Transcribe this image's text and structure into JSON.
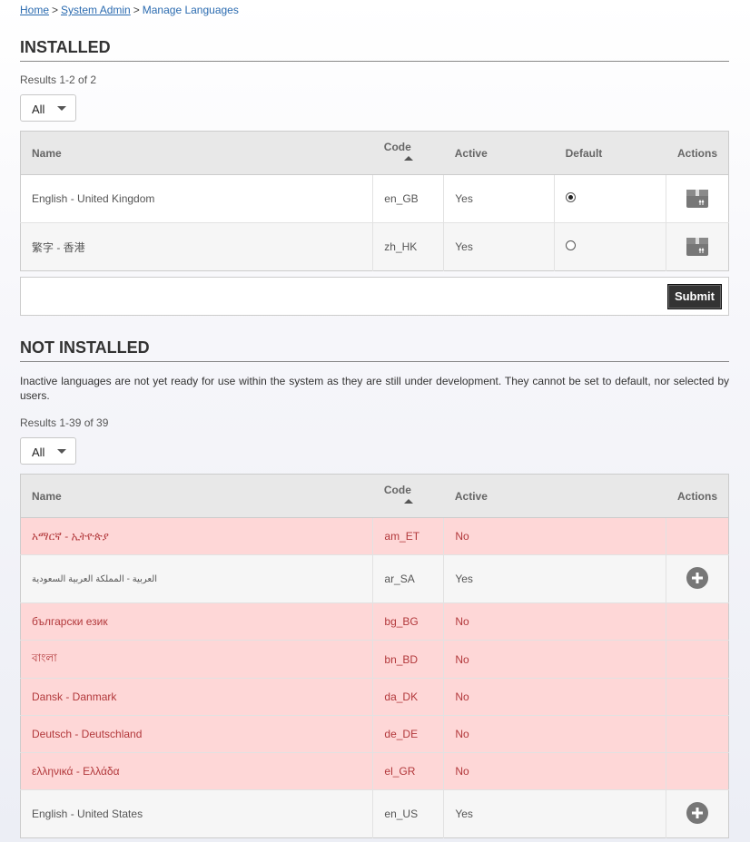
{
  "breadcrumb": {
    "home": "Home",
    "system_admin": "System Admin",
    "current": "Manage Languages",
    "separator": ">"
  },
  "installed": {
    "title": "INSTALLED",
    "results": "Results 1-2 of 2",
    "filter_value": "All",
    "headers": {
      "name": "Name",
      "code": "Code",
      "active": "Active",
      "default": "Default",
      "actions": "Actions"
    },
    "rows": [
      {
        "name": "English - United Kingdom",
        "code": "en_GB",
        "active": "Yes",
        "default_selected": true,
        "action_icon": "package-icon"
      },
      {
        "name": "繁字 - 香港",
        "code": "zh_HK",
        "active": "Yes",
        "default_selected": false,
        "action_icon": "package-icon"
      }
    ],
    "submit_label": "Submit"
  },
  "not_installed": {
    "title": "NOT INSTALLED",
    "description": "Inactive languages are not yet ready for use within the system as they are still under development. They cannot be set to default, nor selected by users.",
    "results": "Results 1-39 of 39",
    "filter_value": "All",
    "headers": {
      "name": "Name",
      "code": "Code",
      "active": "Active",
      "actions": "Actions"
    },
    "rows": [
      {
        "name": "አማርኛ - ኢትዮጵያ",
        "code": "am_ET",
        "active": "No",
        "installable": false
      },
      {
        "name": "العربية - المملكة العربية السعودية",
        "code": "ar_SA",
        "active": "Yes",
        "installable": true
      },
      {
        "name": "български език",
        "code": "bg_BG",
        "active": "No",
        "installable": false
      },
      {
        "name": "বাংলা",
        "code": "bn_BD",
        "active": "No",
        "installable": false
      },
      {
        "name": "Dansk - Danmark",
        "code": "da_DK",
        "active": "No",
        "installable": false
      },
      {
        "name": "Deutsch - Deutschland",
        "code": "de_DE",
        "active": "No",
        "installable": false
      },
      {
        "name": "ελληνικά - Ελλάδα",
        "code": "el_GR",
        "active": "No",
        "installable": false
      },
      {
        "name": "English - United States",
        "code": "en_US",
        "active": "Yes",
        "installable": true
      }
    ]
  },
  "colors": {
    "link": "#2b6bb0",
    "inactive_row_bg": "#fed7d7",
    "inactive_row_text": "#b2383b",
    "header_bg": "#e8e8e8",
    "submit_bg": "#333333"
  }
}
